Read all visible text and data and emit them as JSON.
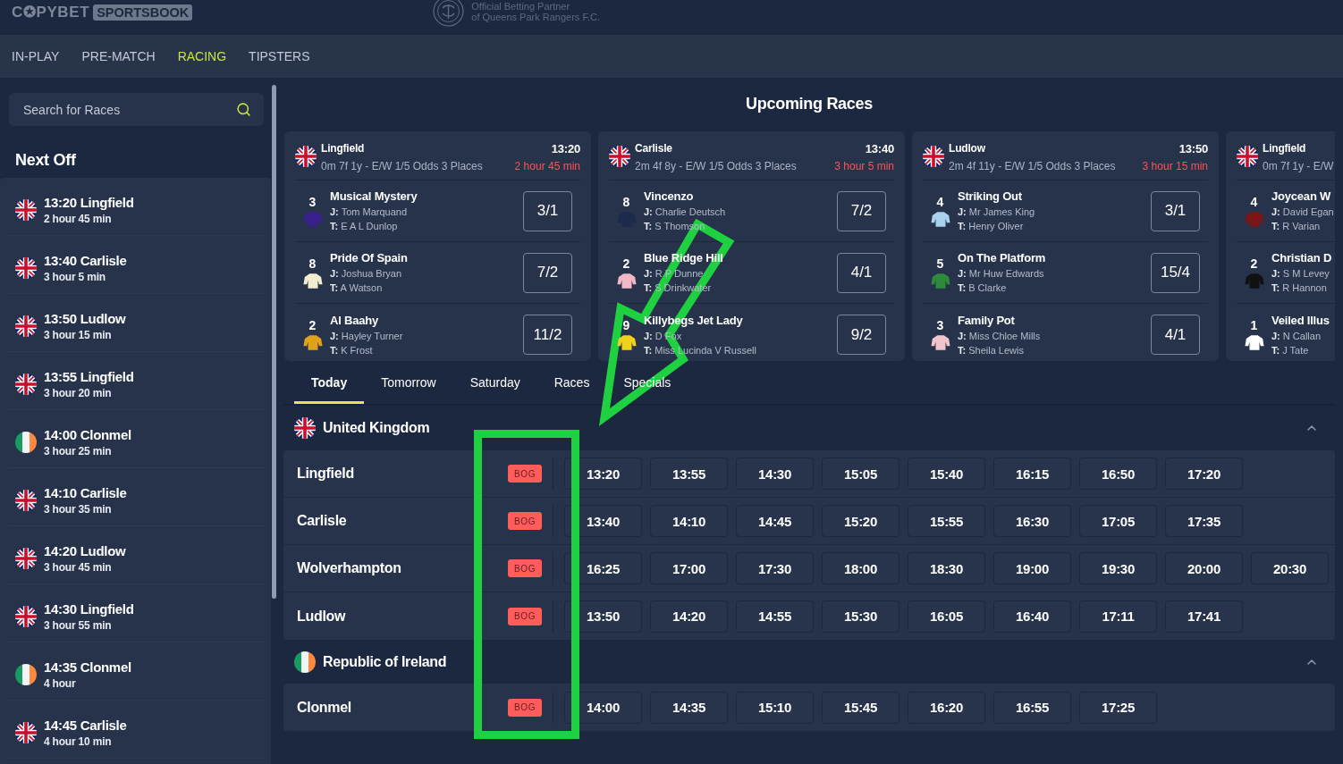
{
  "header": {
    "logo": "C✪PYBET",
    "logo_badge": "SPORTSBOOK",
    "partner_lines": [
      "Official Betting Partner",
      "of Queens Park Rangers F.C."
    ]
  },
  "nav": [
    {
      "label": "IN-PLAY",
      "selected": false
    },
    {
      "label": "PRE-MATCH",
      "selected": false
    },
    {
      "label": "RACING",
      "selected": true
    },
    {
      "label": "TIPSTERS",
      "selected": false
    }
  ],
  "sidebar": {
    "search": {
      "placeholder": "Search for Races"
    },
    "title": "Next Off",
    "items": [
      {
        "kind": "uk",
        "title": "13:20 Lingfield",
        "countdown": "2 hour 45 min"
      },
      {
        "kind": "uk",
        "title": "13:40 Carlisle",
        "countdown": "3 hour 5 min"
      },
      {
        "kind": "uk",
        "title": "13:50 Ludlow",
        "countdown": "3 hour 15 min"
      },
      {
        "kind": "uk",
        "title": "13:55 Lingfield",
        "countdown": "3 hour 20 min"
      },
      {
        "kind": "ireland",
        "title": "14:00 Clonmel",
        "countdown": "3 hour 25 min"
      },
      {
        "kind": "uk",
        "title": "14:10 Carlisle",
        "countdown": "3 hour 35 min"
      },
      {
        "kind": "uk",
        "title": "14:20 Ludlow",
        "countdown": "3 hour 45 min"
      },
      {
        "kind": "uk",
        "title": "14:30 Lingfield",
        "countdown": "3 hour 55 min"
      },
      {
        "kind": "ireland",
        "title": "14:35 Clonmel",
        "countdown": "4 hour"
      },
      {
        "kind": "uk",
        "title": "14:45 Carlisle",
        "countdown": "4 hour 10 min"
      }
    ]
  },
  "upcoming": {
    "title": "Upcoming Races",
    "cards": [
      {
        "kind": "uk",
        "venue": "Lingfield",
        "time": "13:20",
        "details": "0m 7f 1y - E/W 1/5 Odds 3 Places",
        "countdown": "2 hour 45 min",
        "runners": [
          {
            "number": "3",
            "color": "#3a1f8f",
            "name": "Musical Mystery",
            "jockey": "**J:** Tom Marquand",
            "trainer": "**T:** E A L Dunlop",
            "odds": "3/1"
          },
          {
            "number": "8",
            "color": "#f2ecd0",
            "name": "Pride Of Spain",
            "jockey": "**J:** Joshua Bryan",
            "trainer": "**T:** A Watson",
            "odds": "7/2"
          },
          {
            "number": "2",
            "color": "#e0a11d",
            "name": "Al Baahy",
            "jockey": "**J:** Hayley Turner",
            "trainer": "**T:** K Frost",
            "odds": "11/2"
          }
        ]
      },
      {
        "kind": "uk",
        "venue": "Carlisle",
        "time": "13:40",
        "details": "2m 4f 8y - E/W 1/5 Odds 3 Places",
        "countdown": "3 hour 5 min",
        "runners": [
          {
            "number": "8",
            "color": "#1c2a4c",
            "name": "Vincenzo",
            "jockey": "**J:** Charlie Deutsch",
            "trainer": "**T:** S Thomson",
            "odds": "7/2"
          },
          {
            "number": "2",
            "color": "#f2b8c6",
            "name": "Blue Ridge Hill",
            "jockey": "**J:** R P Dunne",
            "trainer": "**T:** S Drinkwater",
            "odds": "4/1"
          },
          {
            "number": "9",
            "color": "#f0d21c",
            "name": "Killybegs Jet Lady",
            "jockey": "**J:** D Fox",
            "trainer": "**T:** Miss Lucinda V Russell",
            "odds": "9/2"
          }
        ]
      },
      {
        "kind": "uk",
        "venue": "Ludlow",
        "time": "13:50",
        "details": "2m 4f 11y - E/W 1/5 Odds 3 Places",
        "countdown": "3 hour 15 min",
        "runners": [
          {
            "number": "4",
            "color": "#a9d2ec",
            "name": "Striking Out",
            "jockey": "**J:** Mr James King",
            "trainer": "**T:** Henry Oliver",
            "odds": "3/1"
          },
          {
            "number": "5",
            "color": "#2d8a3c",
            "name": "On The Platform",
            "jockey": "**J:** Mr Huw Edwards",
            "trainer": "**T:** B Clarke",
            "odds": "15/4"
          },
          {
            "number": "3",
            "color": "#f1c3cb",
            "name": "Family Pot",
            "jockey": "**J:** Miss Chloe Mills",
            "trainer": "**T:** Sheila Lewis",
            "odds": "4/1"
          }
        ]
      },
      {
        "kind": "uk",
        "venue": "Lingfield",
        "details": "0m 7f 1y - E/W",
        "runners": [
          {
            "number": "4",
            "color": "#7d1416",
            "name": "Joycean W",
            "jockey": "**J:** David Egan",
            "trainer": "**T:** R Varian"
          },
          {
            "number": "2",
            "color": "#111111",
            "name": "Christian D",
            "jockey": "**J:** S M Levey",
            "trainer": "**T:** R Hannon"
          },
          {
            "number": "1",
            "color": "#ffffff",
            "name": "Veiled Illus",
            "jockey": "**J:** N Callan",
            "trainer": "**T:** J Tate"
          }
        ]
      }
    ]
  },
  "day_tabs": [
    {
      "label": "Today",
      "selected": true
    },
    {
      "label": "Tomorrow",
      "selected": false
    },
    {
      "label": "Saturday",
      "selected": false
    },
    {
      "label": "Races",
      "selected": false
    },
    {
      "label": "Specials",
      "selected": false
    }
  ],
  "meetings": [
    {
      "kind": "uk",
      "country": "United Kingdom",
      "expanded": true,
      "venues": [
        {
          "name": "Lingfield",
          "badge": "BOG",
          "times": [
            "13:20",
            "13:55",
            "14:30",
            "15:05",
            "15:40",
            "16:15",
            "16:50",
            "17:20"
          ]
        },
        {
          "name": "Carlisle",
          "badge": "BOG",
          "times": [
            "13:40",
            "14:10",
            "14:45",
            "15:20",
            "15:55",
            "16:30",
            "17:05",
            "17:35"
          ]
        },
        {
          "name": "Wolverhampton",
          "badge": "BOG",
          "times": [
            "16:25",
            "17:00",
            "17:30",
            "18:00",
            "18:30",
            "19:00",
            "19:30",
            "20:00",
            "20:30"
          ]
        },
        {
          "name": "Ludlow",
          "badge": "BOG",
          "times": [
            "13:50",
            "14:20",
            "14:55",
            "15:30",
            "16:05",
            "16:40",
            "17:11",
            "17:41"
          ]
        }
      ]
    },
    {
      "kind": "ireland",
      "country": "Republic of Ireland",
      "expanded": true,
      "venues": [
        {
          "name": "Clonmel",
          "badge": "BOG",
          "times": [
            "14:00",
            "14:35",
            "15:10",
            "15:45",
            "16:20",
            "16:55",
            "17:25"
          ]
        }
      ]
    }
  ]
}
